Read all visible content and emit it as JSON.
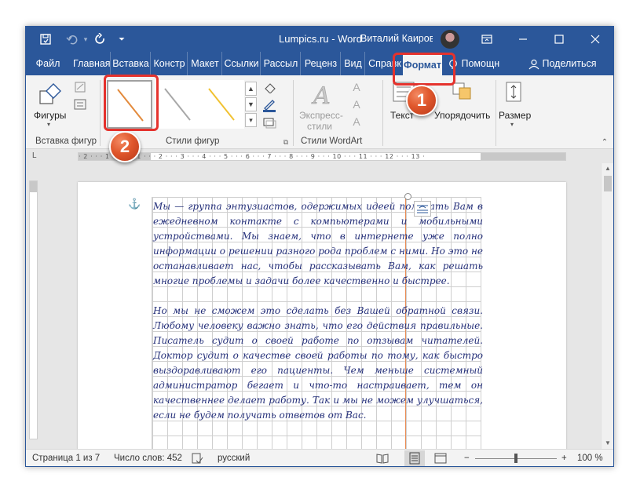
{
  "titlebar": {
    "title": "Lumpics.ru  -  Word",
    "user_name": "Виталий Каиров",
    "save_icon": "save-icon",
    "undo_icon": "undo-icon",
    "redo_icon": "redo-icon",
    "customize_icon": "customize-icon",
    "ribbon_display_icon": "ribbon-display-icon",
    "minimize_icon": "minimize-icon",
    "maximize_icon": "maximize-icon",
    "close_icon": "close-icon"
  },
  "tabs": [
    {
      "label": "Файл"
    },
    {
      "label": "Главная"
    },
    {
      "label": "Вставка"
    },
    {
      "label": "Констр"
    },
    {
      "label": "Макет"
    },
    {
      "label": "Ссылки"
    },
    {
      "label": "Рассыл"
    },
    {
      "label": "Реценз"
    },
    {
      "label": "Вид"
    },
    {
      "label": "Справк"
    },
    {
      "label": "Формат"
    }
  ],
  "tabs_extra": {
    "help_label": "Помощн",
    "share_label": "Поделиться"
  },
  "ribbon": {
    "shapes_label": "Фигуры",
    "insert_shapes_group": "Вставка фигур",
    "shape_styles_group": "Стили фигур",
    "wordart_group": "Стили WordArt",
    "express_styles_line1": "Экспресс-",
    "express_styles_line2": "стили",
    "text_label": "Текст",
    "arrange_label": "Упорядочить",
    "size_label": "Размер"
  },
  "shape_styles": [
    {
      "color": "#e38a3c",
      "selected": true
    },
    {
      "color": "#a8a8a8",
      "selected": false
    },
    {
      "color": "#f1c232",
      "selected": false
    }
  ],
  "ruler": {
    "text": "· 2 · · · 1 · · · · · 1 · · · 2 · · · 3 · · · 4 · · · 5 · · · 6 · · · 7 · · · 8 · · · 9 · · · 10 · · · 11 · · · 12 · · · 13 ·"
  },
  "document": {
    "paragraphs": [
      "Мы — группа энтузиастов, одержимых идеей помогать Вам в ежедневном контакте с компьютерами и мобильными устройствами. Мы знаем, что в интернете уже полно информации о решении разного рода проблем с ними. Но это не останавливает нас, чтобы рассказывать Вам, как решать многие проблемы и задачи более качественно и быстрее.",
      "Но мы не сможем это сделать без Вашей обратной связи. Любому человеку важно знать, что его действия правильные. Писатель судит о своей работе по отзывам читателей. Доктор судит о качестве своей работы по тому, как быстро выздоравливают его пациенты. Чем меньше системный администратор бегает и что-то настраивает, тем он качественнее делает работу. Так и мы не можем улучшаться, если не будем получать ответов от Вас."
    ]
  },
  "statusbar": {
    "page": "Страница 1 из 7",
    "words": "Число слов: 452",
    "language": "русский",
    "zoom": "100 %",
    "zoom_minus": "−",
    "zoom_plus": "+"
  },
  "callouts": {
    "one": "1",
    "two": "2"
  },
  "colors": {
    "brand": "#2b579a",
    "callout": "#e0572c",
    "highlight": "#e5322d"
  }
}
